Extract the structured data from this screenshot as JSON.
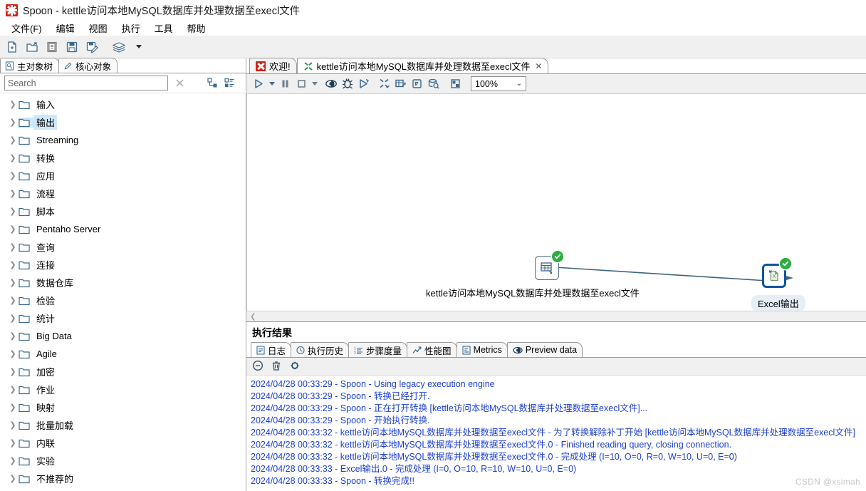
{
  "window": {
    "title": "Spoon - kettle访问本地MySQL数据库并处理数据至execl文件",
    "logo_icon": "spoon-logo-icon"
  },
  "menubar": {
    "items": [
      {
        "label": "文件(F)",
        "name": "menu-file"
      },
      {
        "label": "编辑",
        "name": "menu-edit"
      },
      {
        "label": "视图",
        "name": "menu-view"
      },
      {
        "label": "执行",
        "name": "menu-run"
      },
      {
        "label": "工具",
        "name": "menu-tools"
      },
      {
        "label": "帮助",
        "name": "menu-help"
      }
    ]
  },
  "main_toolbar": {
    "buttons": [
      {
        "name": "new-file-icon"
      },
      {
        "name": "open-file-icon"
      },
      {
        "name": "explore-repository-icon"
      },
      {
        "name": "save-icon"
      },
      {
        "name": "save-as-icon"
      },
      {
        "name": "layers-icon"
      },
      {
        "name": "dropdown-caret-icon"
      }
    ]
  },
  "left_panel": {
    "tabs": [
      {
        "label": "主对象树",
        "icon": "document-tree-icon",
        "active": true
      },
      {
        "label": "核心对象",
        "icon": "pencil-icon",
        "active": false
      }
    ],
    "search": {
      "placeholder": "Search",
      "value": ""
    },
    "clear_icon": "clear-x-icon",
    "expand_icon": "expand-tree-icon",
    "collapse_icon": "collapse-tree-icon",
    "tree_items": [
      {
        "label": "输入",
        "selected": false
      },
      {
        "label": "输出",
        "selected": true
      },
      {
        "label": "Streaming",
        "selected": false
      },
      {
        "label": "转换",
        "selected": false
      },
      {
        "label": "应用",
        "selected": false
      },
      {
        "label": "流程",
        "selected": false
      },
      {
        "label": "脚本",
        "selected": false
      },
      {
        "label": "Pentaho Server",
        "selected": false
      },
      {
        "label": "查询",
        "selected": false
      },
      {
        "label": "连接",
        "selected": false
      },
      {
        "label": "数据仓库",
        "selected": false
      },
      {
        "label": "检验",
        "selected": false
      },
      {
        "label": "统计",
        "selected": false
      },
      {
        "label": "Big Data",
        "selected": false
      },
      {
        "label": "Agile",
        "selected": false
      },
      {
        "label": "加密",
        "selected": false
      },
      {
        "label": "作业",
        "selected": false
      },
      {
        "label": "映射",
        "selected": false
      },
      {
        "label": "批量加载",
        "selected": false
      },
      {
        "label": "内联",
        "selected": false
      },
      {
        "label": "实验",
        "selected": false
      },
      {
        "label": "不推荐的",
        "selected": false
      }
    ]
  },
  "editor": {
    "tabs": [
      {
        "label": "欢迎!",
        "icon": "spoon-logo-icon",
        "active": false,
        "closable": false
      },
      {
        "label": "kettle访问本地MySQL数据库并处理数据至execl文件",
        "icon": "transformation-icon",
        "active": true,
        "closable": true,
        "close_label": "✕"
      }
    ],
    "toolbar": {
      "buttons": [
        {
          "name": "run-icon"
        },
        {
          "name": "run-dropdown-caret-icon"
        },
        {
          "name": "pause-icon"
        },
        {
          "name": "stop-icon"
        },
        {
          "name": "stop-dropdown-caret-icon"
        },
        {
          "name": "preview-icon"
        },
        {
          "name": "debug-icon"
        },
        {
          "name": "replay-icon"
        },
        {
          "name": "transformation-settings-icon"
        },
        {
          "name": "show-grid-icon"
        },
        {
          "name": "show-impact-icon"
        },
        {
          "name": "sql-inspect-icon"
        },
        {
          "name": "align-icon"
        }
      ],
      "zoom": {
        "value": "100%",
        "chevron": "⌄"
      }
    },
    "canvas": {
      "nodes": [
        {
          "id": "table-input",
          "label": "kettle访问本地MySQL数据库并处理数据至execl文件",
          "icon": "table-input-icon",
          "status": "success",
          "selected": false
        },
        {
          "id": "excel-output",
          "label": "Excel输出",
          "icon": "excel-output-icon",
          "status": "success",
          "selected": true
        }
      ],
      "hop": {
        "from": "table-input",
        "to": "excel-output",
        "arrow": "arrowhead-icon"
      }
    },
    "hscroll": {
      "left_chevron": "❮"
    }
  },
  "results": {
    "title": "执行结果",
    "tabs": [
      {
        "label": "日志",
        "icon": "log-icon",
        "active": true
      },
      {
        "label": "执行历史",
        "icon": "history-clock-icon",
        "active": false
      },
      {
        "label": "步骤度量",
        "icon": "step-metrics-icon",
        "active": false
      },
      {
        "label": "性能图",
        "icon": "performance-graph-icon",
        "active": false
      },
      {
        "label": "Metrics",
        "icon": "metrics-icon",
        "active": false
      },
      {
        "label": "Preview data",
        "icon": "preview-data-icon",
        "active": false
      }
    ],
    "toolbar": [
      {
        "name": "clear-log-icon"
      },
      {
        "name": "delete-icon"
      },
      {
        "name": "log-settings-gear-icon"
      }
    ],
    "log_color": "#1c3fd6",
    "log_lines": [
      "2024/04/28 00:33:29 - Spoon - Using legacy execution engine",
      "2024/04/28 00:33:29 - Spoon - 转换已经打开.",
      "2024/04/28 00:33:29 - Spoon - 正在打开转换 [kettle访问本地MySQL数据库并处理数据至execl文件]...",
      "2024/04/28 00:33:29 - Spoon - 开始执行转换.",
      "2024/04/28 00:33:32 - kettle访问本地MySQL数据库并处理数据至execl文件 - 为了转换解除补丁开始  [kettle访问本地MySQL数据库并处理数据至execl文件]",
      "2024/04/28 00:33:32 - kettle访问本地MySQL数据库并处理数据至execl文件.0 - Finished reading query, closing connection.",
      "2024/04/28 00:33:32 - kettle访问本地MySQL数据库并处理数据至execl文件.0 - 完成处理 (I=10, O=0, R=0, W=10, U=0, E=0)",
      "2024/04/28 00:33:33 - Excel输出.0 - 完成处理 (I=0, O=10, R=10, W=10, U=0, E=0)",
      "2024/04/28 00:33:33 - Spoon - 转换完成!!"
    ]
  },
  "watermark": {
    "text": "CSDN @xsimah"
  },
  "colors": {
    "accent_blue": "#3b6a91",
    "selected_node_border": "#1054a0",
    "success_green": "#2bad3f",
    "log_blue": "#1c3fd6",
    "tree_selection": "#cde8fb",
    "toolbar_bg": "#f0f0f0"
  }
}
